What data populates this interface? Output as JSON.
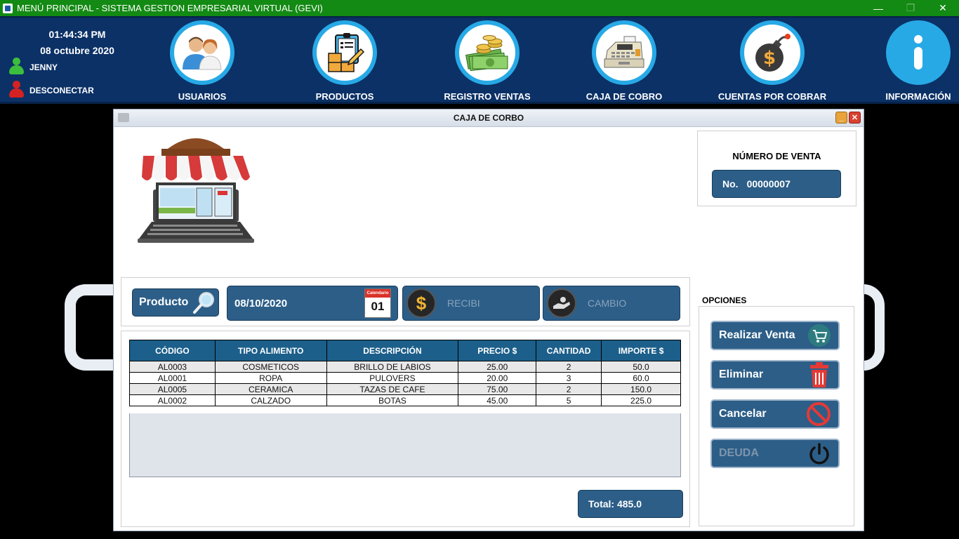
{
  "window": {
    "title": "MENÚ PRINCIPAL - SISTEMA GESTION EMPRESARIAL VIRTUAL (GEVI)",
    "minimize": "—",
    "maximize": "❐",
    "close": "✕"
  },
  "header": {
    "time": "01:44:34 PM",
    "date": "08 octubre 2020",
    "user": "JENNY",
    "disconnect": "DESCONECTAR",
    "nav": [
      {
        "label": "USUARIOS",
        "icon": "users-icon"
      },
      {
        "label": "PRODUCTOS",
        "icon": "products-icon"
      },
      {
        "label": "REGISTRO VENTAS",
        "icon": "money-icon"
      },
      {
        "label": "CAJA DE COBRO",
        "icon": "cash-register-icon"
      },
      {
        "label": "CUENTAS POR COBRAR",
        "icon": "money-bomb-icon"
      },
      {
        "label": "INFORMACIÓN",
        "icon": "info-icon"
      }
    ]
  },
  "cashier": {
    "title": "CAJA DE CORBO",
    "sale_number_title": "NÚMERO DE VENTA",
    "sale_number_prefix": "No.",
    "sale_number": "00000007",
    "producto_label": "Producto",
    "date_value": "08/10/2020",
    "calendar_text": "Calendario",
    "calendar_day": "01",
    "recibi_placeholder": "RECIBI",
    "cambio_placeholder": "CAMBIO",
    "table": {
      "columns": [
        "CÓDIGO",
        "TIPO ALIMENTO",
        "DESCRIPCIÓN",
        "PRECIO $",
        "CANTIDAD",
        "IMPORTE $"
      ],
      "rows": [
        [
          "AL0003",
          "COSMETICOS",
          "BRILLO DE LABIOS",
          "25.00",
          "2",
          "50.0"
        ],
        [
          "AL0001",
          "ROPA",
          "PULOVERS",
          "20.00",
          "3",
          "60.0"
        ],
        [
          "AL0005",
          "CERAMICA",
          "TAZAS DE CAFE",
          "75.00",
          "2",
          "150.0"
        ],
        [
          "AL0002",
          "CALZADO",
          "BOTAS",
          "45.00",
          "5",
          "225.0"
        ]
      ]
    },
    "total": "Total: 485.0",
    "options_title": "OPCIONES",
    "buttons": {
      "realizar": "Realizar Venta",
      "eliminar": "Eliminar",
      "cancelar": "Cancelar",
      "deuda": "DEUDA"
    }
  },
  "colors": {
    "titlebar": "#138a13",
    "nav_bg": "#0b3166",
    "accent_blue": "#27a9e6",
    "button_blue": "#2c5e88",
    "table_header": "#1c5f8a"
  }
}
